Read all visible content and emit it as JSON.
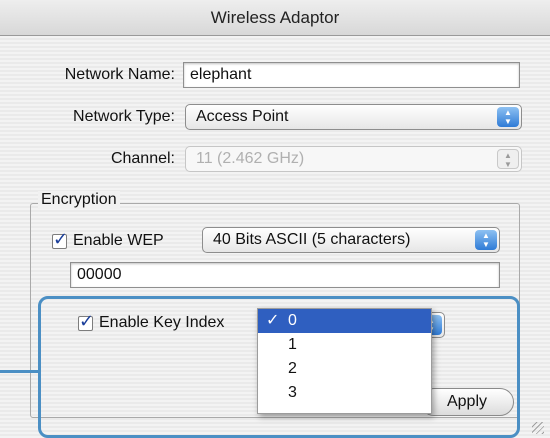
{
  "window": {
    "title": "Wireless Adaptor"
  },
  "form": {
    "network_name_label": "Network Name:",
    "network_name_value": "elephant",
    "network_type_label": "Network Type:",
    "network_type_value": "Access Point",
    "channel_label": "Channel:",
    "channel_value": "11 (2.462 GHz)"
  },
  "encryption": {
    "group_label": "Encryption",
    "enable_wep_label": "Enable WEP",
    "enable_wep_checked": true,
    "wep_type_value": "40 Bits ASCII (5 characters)",
    "key_value": "00000",
    "enable_key_index_label": "Enable Key Index",
    "enable_key_index_checked": true
  },
  "key_index_menu": {
    "check_glyph": "✓",
    "items": [
      "0",
      "1",
      "2",
      "3"
    ],
    "selected_index": 0
  },
  "buttons": {
    "apply_label": "Apply"
  },
  "icons": {
    "popup_arrows": "stepper-arrows-icon",
    "checkmark": "checkmark-icon",
    "resize": "resize-grip-icon"
  },
  "colors": {
    "accent": "#2f5fc0",
    "callout": "#4b8fc4"
  }
}
